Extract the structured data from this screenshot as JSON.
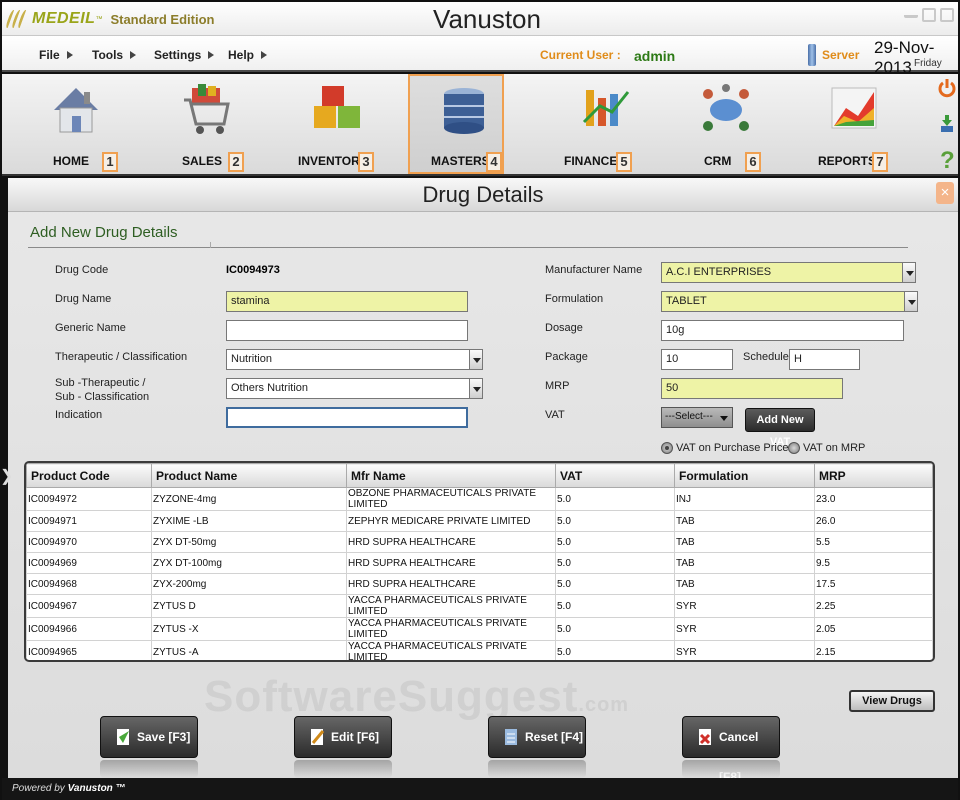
{
  "titlebar": {
    "brand": "MEDEIL",
    "tm": "™",
    "edition": "Standard Edition",
    "app_title": "Vanuston"
  },
  "menubar": {
    "menus": [
      "File",
      "Tools",
      "Settings",
      "Help"
    ],
    "current_user_label": "Current User :",
    "current_user": "admin",
    "server_label": "Server",
    "date": "29-Nov-2013",
    "day": "Friday"
  },
  "toolbar": {
    "items": [
      {
        "label": "HOME",
        "num": "1",
        "icon": "home-icon"
      },
      {
        "label": "SALES",
        "num": "2",
        "icon": "cart-icon"
      },
      {
        "label": "INVENTORY",
        "num": "3",
        "icon": "boxes-icon"
      },
      {
        "label": "MASTERS",
        "num": "4",
        "icon": "database-icon"
      },
      {
        "label": "FINANCE",
        "num": "5",
        "icon": "finance-icon"
      },
      {
        "label": "CRM",
        "num": "6",
        "icon": "crm-icon"
      },
      {
        "label": "REPORTS",
        "num": "7",
        "icon": "reports-icon"
      }
    ],
    "active": "MASTERS"
  },
  "panel": {
    "title": "Drug Details",
    "close": "×",
    "section_title": "Add New Drug Details"
  },
  "form": {
    "drug_code_label": "Drug Code",
    "drug_code": "IC0094973",
    "drug_name_label": "Drug Name",
    "drug_name": "stamina",
    "generic_name_label": "Generic Name",
    "generic_name": "",
    "therapeutic_label": "Therapeutic / Classification",
    "therapeutic": "Nutrition",
    "sub_therapeutic_label_1": "Sub -Therapeutic /",
    "sub_therapeutic_label_2": "Sub - Classification",
    "sub_therapeutic": "Others Nutrition",
    "indication_label": "Indication",
    "indication": "",
    "manufacturer_label": "Manufacturer Name",
    "manufacturer": "A.C.I ENTERPRISES",
    "formulation_label": "Formulation",
    "formulation": "TABLET",
    "dosage_label": "Dosage",
    "dosage": "10g",
    "package_label": "Package",
    "package": "10",
    "schedule_label": "Schedule",
    "schedule": "H",
    "mrp_label": "MRP",
    "mrp": "50",
    "vat_label": "VAT",
    "vat_select": "---Select---",
    "add_vat": "Add New VAT",
    "vat_purchase": "VAT on Purchase Price",
    "vat_mrp": "VAT on MRP"
  },
  "table": {
    "headers": [
      "Product Code",
      "Product Name",
      "Mfr Name",
      "VAT",
      "Formulation",
      "MRP"
    ],
    "rows": [
      [
        "IC0094972",
        "ZYZONE-4mg",
        "OBZONE PHARMACEUTICALS PRIVATE LIMITED",
        "5.0",
        "INJ",
        "23.0"
      ],
      [
        "IC0094971",
        "ZYXIME -LB",
        "ZEPHYR MEDICARE PRIVATE LIMITED",
        "5.0",
        "TAB",
        "26.0"
      ],
      [
        "IC0094970",
        "ZYX DT-50mg",
        "HRD SUPRA HEALTHCARE",
        "5.0",
        "TAB",
        "5.5"
      ],
      [
        "IC0094969",
        "ZYX DT-100mg",
        "HRD SUPRA HEALTHCARE",
        "5.0",
        "TAB",
        "9.5"
      ],
      [
        "IC0094968",
        "ZYX-200mg",
        "HRD SUPRA HEALTHCARE",
        "5.0",
        "TAB",
        "17.5"
      ],
      [
        "IC0094967",
        "ZYTUS D",
        "YACCA PHARMACEUTICALS PRIVATE LIMITED",
        "5.0",
        "SYR",
        "2.25"
      ],
      [
        "IC0094966",
        "ZYTUS -X",
        "YACCA PHARMACEUTICALS PRIVATE LIMITED",
        "5.0",
        "SYR",
        "2.05"
      ],
      [
        "IC0094965",
        "ZYTUS -A",
        "YACCA PHARMACEUTICALS PRIVATE LIMITED",
        "5.0",
        "SYR",
        "2.15"
      ]
    ]
  },
  "actions": {
    "view_drugs": "View Drugs",
    "save": "Save [F3]",
    "edit": "Edit [F6]",
    "reset": "Reset [F4]",
    "cancel": "Cancel [F8]"
  },
  "watermark": {
    "main": "SoftwareSuggest",
    "suffix": ".com"
  },
  "footer": {
    "powered": "Powered by",
    "brand": "Vanuston ™"
  },
  "colors": {
    "accent_orange": "#e08c1a",
    "accent_green": "#2d7a16",
    "highlight_yellow": "#eef3a6",
    "active_border": "#f0a050"
  }
}
